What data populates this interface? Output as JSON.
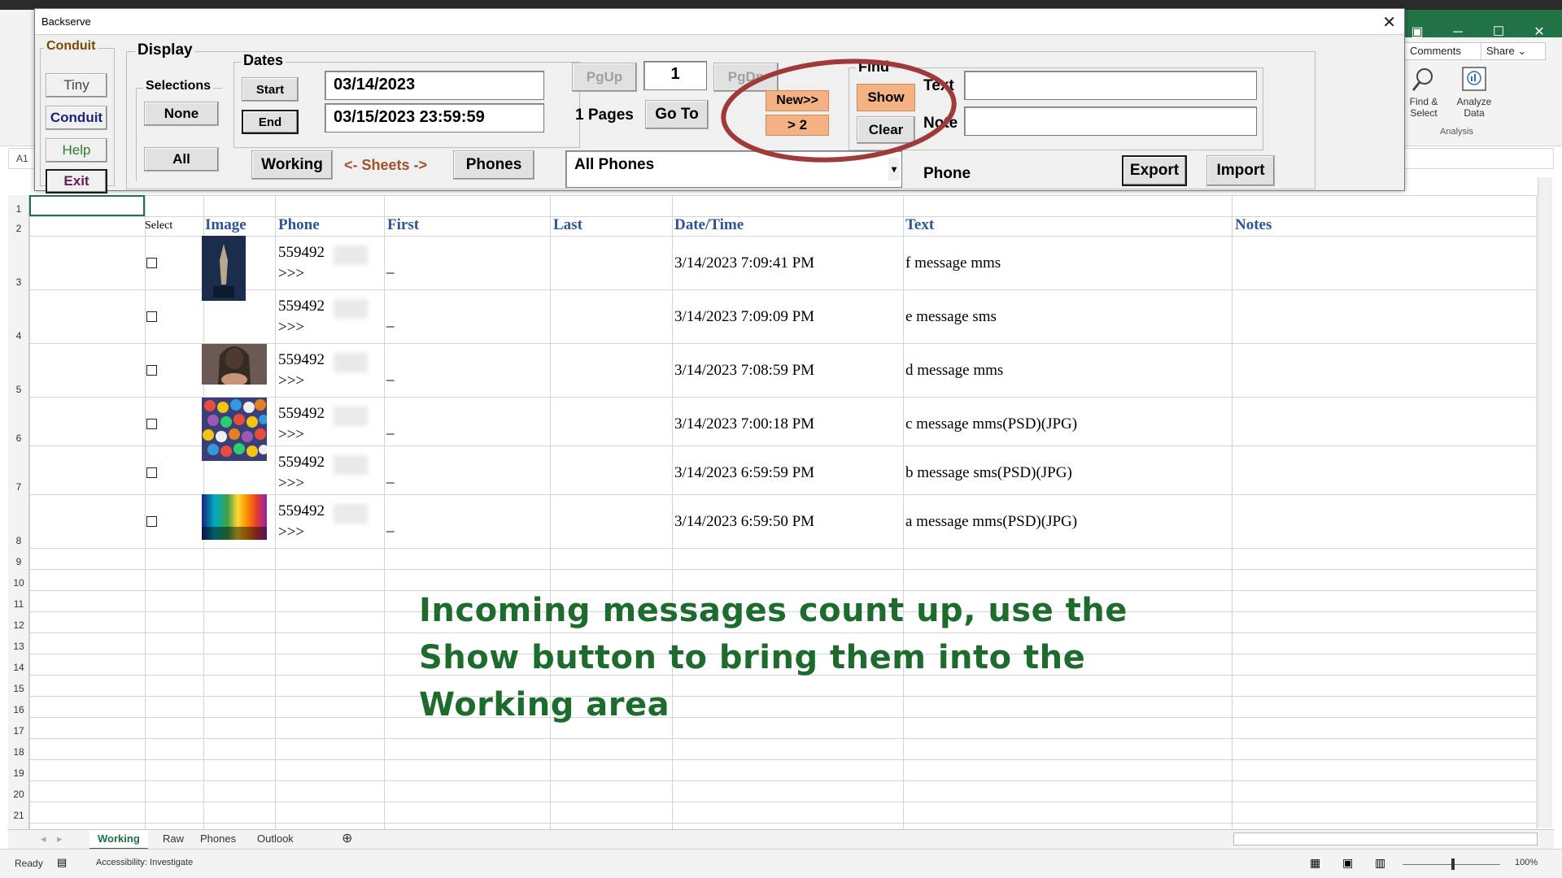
{
  "dialog": {
    "title": "Backserve",
    "close_glyph": "✕",
    "conduit": {
      "label": "Conduit",
      "tiny": "Tiny",
      "conduit": "Conduit",
      "help": "Help",
      "exit": "Exit"
    },
    "display": {
      "label": "Display",
      "selections": {
        "label": "Selections",
        "none": "None",
        "all": "All"
      },
      "dates": {
        "label": "Dates",
        "start_label": "Start",
        "end_label": "End",
        "start_value": "03/14/2023",
        "end_value": "03/15/2023 23:59:59"
      },
      "working": "Working",
      "sheets": "<- Sheets ->",
      "phones": "Phones"
    },
    "paging": {
      "pgup": "PgUp",
      "page_value": "1",
      "pgdn": "PgDn",
      "pages_text": "1 Pages",
      "goto": "Go To"
    },
    "new_btn": "New>>",
    "new_count": "> 2",
    "phone_select": "All Phones",
    "find": {
      "label": "Find",
      "show": "Show",
      "clear": "Clear",
      "text_label": "Text",
      "note_label": "Note",
      "text_value": "",
      "note_value": "",
      "phone_label": "Phone",
      "export": "Export",
      "import": "Import"
    }
  },
  "excel": {
    "ribbon": {
      "comments": "Comments",
      "share": "Share",
      "find_select": "Find & Select",
      "analyze_data": "Analyze Data",
      "analysis_group": "Analysis"
    },
    "namebox": "A1",
    "rows": [
      "1",
      "2",
      "3",
      "4",
      "5",
      "6",
      "7",
      "8",
      "9",
      "10",
      "11",
      "12",
      "13",
      "14",
      "15",
      "16",
      "17",
      "18",
      "19",
      "20",
      "21"
    ],
    "headers": {
      "select": "Select",
      "image": "Image",
      "phone": "Phone",
      "first": "First",
      "last": "Last",
      "datetime": "Date/Time",
      "text": "Text",
      "notes": "Notes"
    },
    "messages": [
      {
        "phone": "559492",
        "arrows": ">>>",
        "first": "_",
        "datetime": "3/14/2023 7:09:41 PM",
        "text": "f message mms"
      },
      {
        "phone": "559492",
        "arrows": ">>>",
        "first": "_",
        "datetime": "3/14/2023 7:09:09 PM",
        "text": "e message sms"
      },
      {
        "phone": "559492",
        "arrows": ">>>",
        "first": "_",
        "datetime": "3/14/2023 7:08:59 PM",
        "text": "d message mms"
      },
      {
        "phone": "559492",
        "arrows": ">>>",
        "first": "_",
        "datetime": "3/14/2023 7:00:18 PM",
        "text": "c message mms(PSD)(JPG)"
      },
      {
        "phone": "559492",
        "arrows": ">>>",
        "first": "_",
        "datetime": "3/14/2023 6:59:59 PM",
        "text": "b message sms(PSD)(JPG)"
      },
      {
        "phone": "559492",
        "arrows": ">>>",
        "first": "_",
        "datetime": "3/14/2023 6:59:50 PM",
        "text": "a message mms(PSD)(JPG)"
      }
    ],
    "annotation": "Incoming messages count up, use the Show button to bring them into the Working area",
    "tabs": [
      "Working",
      "Raw",
      "Phones",
      "Outlook"
    ],
    "status": {
      "ready": "Ready",
      "accessibility": "Accessibility: Investigate",
      "zoom": "100%"
    }
  },
  "colors": {
    "accent_orange": "#f4b183",
    "header_blue": "#2f5496",
    "annotation_green": "#1e6b2e",
    "excel_green": "#217346",
    "highlight_circle": "#a03a3a"
  }
}
